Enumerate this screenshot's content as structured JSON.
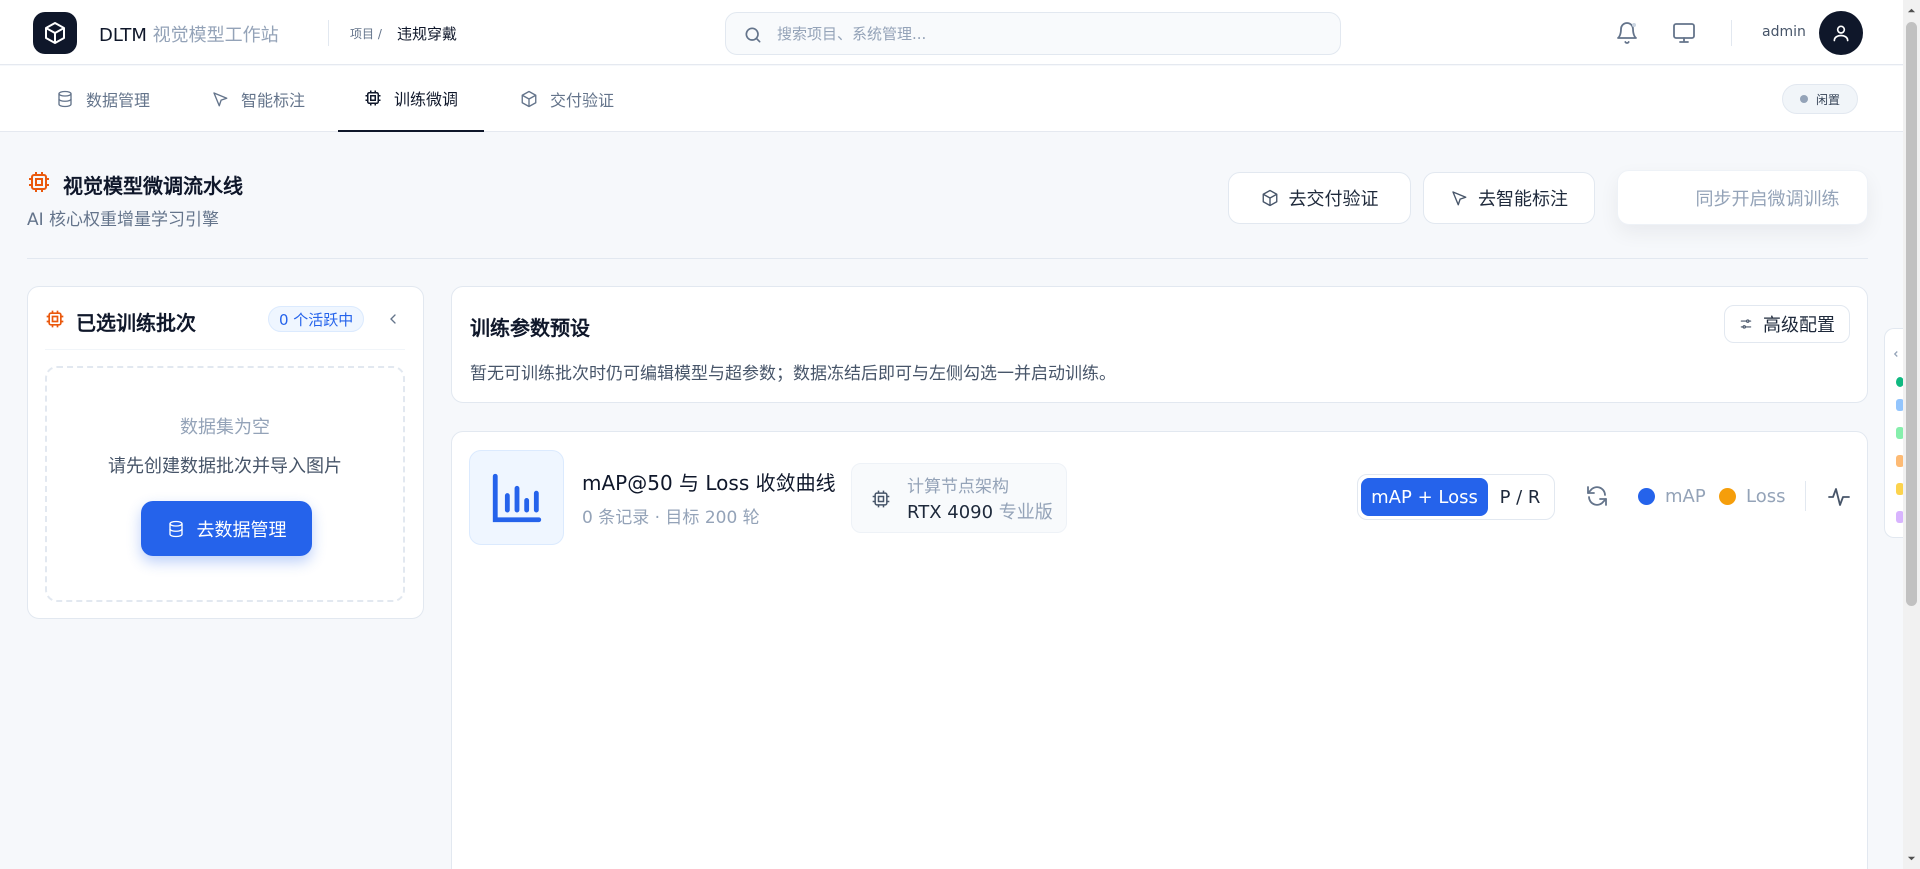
{
  "app": {
    "brand_name": "DLTM",
    "brand_suffix": "视觉模型工作站"
  },
  "breadcrumb": {
    "prefix": "项目 /",
    "current": "违规穿戴"
  },
  "search": {
    "placeholder": "搜索项目、系统管理..."
  },
  "user": {
    "name": "admin"
  },
  "tabs": [
    {
      "label": "数据管理",
      "icon": "database-icon"
    },
    {
      "label": "智能标注",
      "icon": "cursor-pointer-icon"
    },
    {
      "label": "训练微调",
      "icon": "chip-icon",
      "active": true
    },
    {
      "label": "交付验证",
      "icon": "box-icon"
    }
  ],
  "status": {
    "label": "闲置"
  },
  "page_header": {
    "title": "视觉模型微调流水线",
    "subtitle": "AI 核心权重增量学习引擎",
    "btn_delivery": "去交付验证",
    "btn_annotate": "去智能标注",
    "btn_sync_train": "同步开启微调训练"
  },
  "batches_panel": {
    "title": "已选训练批次",
    "badge": "0 个活跃中",
    "empty_title": "数据集为空",
    "empty_sub": "请先创建数据批次并导入图片",
    "go_button": "去数据管理"
  },
  "params_panel": {
    "title": "训练参数预设",
    "description": "暂无可训练批次时仍可编辑模型与超参数；数据冻结后即可与左侧勾选一并启动训练。",
    "advanced_button": "高级配置"
  },
  "curve_panel": {
    "title": "mAP@50 与 Loss 收敛曲线",
    "meta": "0 条记录 · 目标 200 轮",
    "node_label": "计算节点架构",
    "node_value": "RTX 4090",
    "node_edition": "专业版",
    "seg_active": "mAP + Loss",
    "seg_other": "P / R",
    "legend": [
      {
        "label": "mAP",
        "color": "#2563eb"
      },
      {
        "label": "Loss",
        "color": "#f59e0b"
      }
    ]
  },
  "colors": {
    "primary": "#2563eb",
    "accent_orange": "#ea580c",
    "dark": "#0f172a"
  }
}
